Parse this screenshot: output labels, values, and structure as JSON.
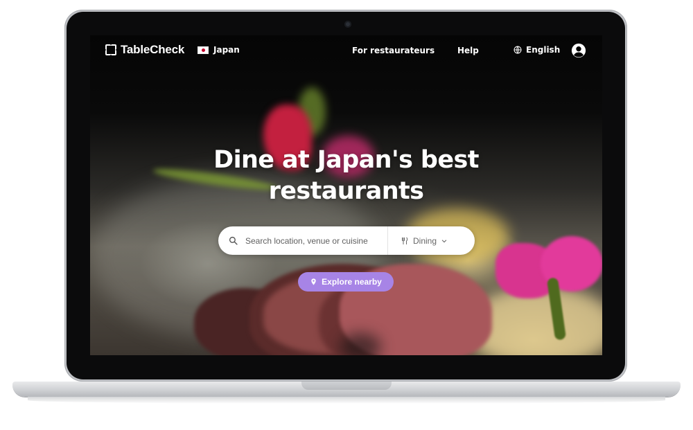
{
  "brand": {
    "name": "TableCheck"
  },
  "nav": {
    "country": "Japan",
    "for_restaurateurs": "For restaurateurs",
    "help": "Help",
    "language": "English"
  },
  "hero": {
    "headline_line1": "Dine at Japan's best",
    "headline_line2": "restaurants"
  },
  "search": {
    "placeholder": "Search location, venue or cuisine",
    "category_selected": "Dining"
  },
  "explore_button": {
    "label": "Explore nearby"
  },
  "colors": {
    "accent": "#a784e6",
    "nav_text": "#ffffff",
    "search_bg": "#ffffff",
    "laptop_frame": "#bfc1c5",
    "bezel": "#0b0b0c"
  },
  "icons": {
    "logo": "tablecheck-logo-icon",
    "flag": "japan-flag-icon",
    "globe": "globe-icon",
    "account": "user-account-icon",
    "search": "search-icon",
    "dining": "utensils-icon",
    "chevron": "chevron-down-icon",
    "pin": "location-pin-icon"
  }
}
